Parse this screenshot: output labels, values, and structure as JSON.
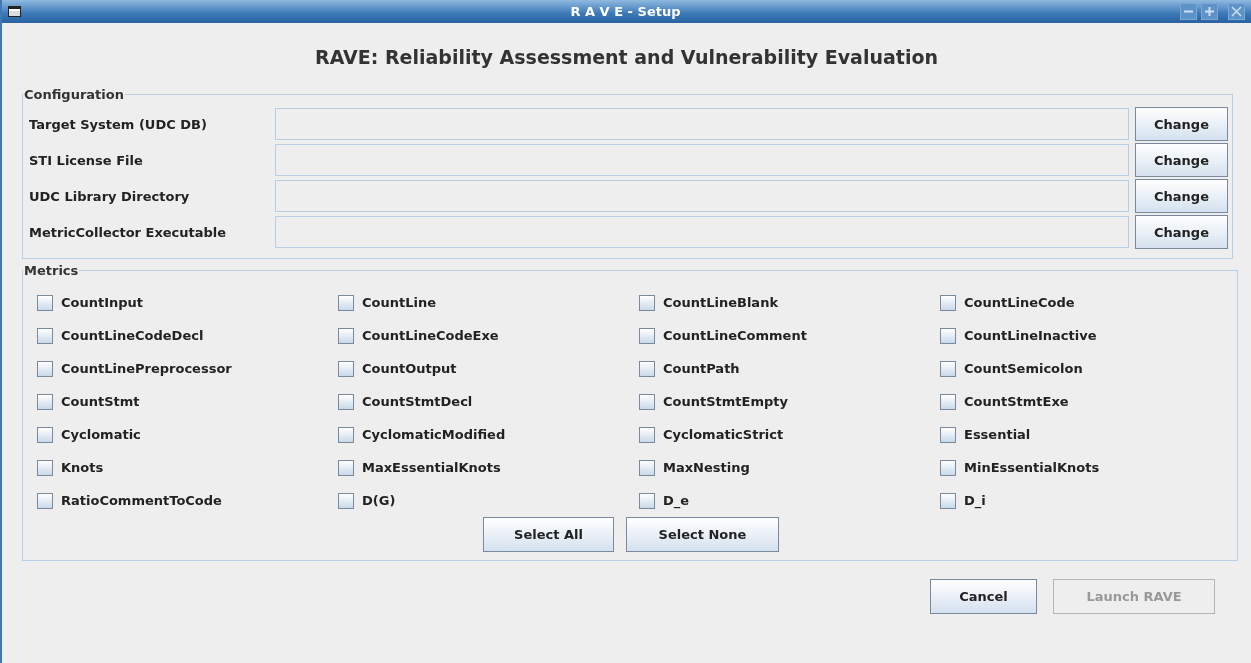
{
  "window": {
    "title": "R A V E - Setup"
  },
  "heading": "RAVE: Reliability Assessment and Vulnerability Evaluation",
  "configuration": {
    "legend": "Configuration",
    "rows": [
      {
        "label": "Target System (UDC DB)",
        "button": "Change"
      },
      {
        "label": "STI License File",
        "button": "Change"
      },
      {
        "label": "UDC Library Directory",
        "button": "Change"
      },
      {
        "label": "MetricCollector Executable",
        "button": "Change"
      }
    ]
  },
  "metrics": {
    "legend": "Metrics",
    "items": [
      {
        "label": "CountInput",
        "checked": false
      },
      {
        "label": "CountLine",
        "checked": false
      },
      {
        "label": "CountLineBlank",
        "checked": false
      },
      {
        "label": "CountLineCode",
        "checked": false
      },
      {
        "label": "CountLineCodeDecl",
        "checked": false
      },
      {
        "label": "CountLineCodeExe",
        "checked": false
      },
      {
        "label": "CountLineComment",
        "checked": false
      },
      {
        "label": "CountLineInactive",
        "checked": false
      },
      {
        "label": "CountLinePreprocessor",
        "checked": false
      },
      {
        "label": "CountOutput",
        "checked": false
      },
      {
        "label": "CountPath",
        "checked": false
      },
      {
        "label": "CountSemicolon",
        "checked": false
      },
      {
        "label": "CountStmt",
        "checked": false
      },
      {
        "label": "CountStmtDecl",
        "checked": false
      },
      {
        "label": "CountStmtEmpty",
        "checked": false
      },
      {
        "label": "CountStmtExe",
        "checked": false
      },
      {
        "label": "Cyclomatic",
        "checked": false
      },
      {
        "label": "CyclomaticModified",
        "checked": false
      },
      {
        "label": "CyclomaticStrict",
        "checked": false
      },
      {
        "label": "Essential",
        "checked": false
      },
      {
        "label": "Knots",
        "checked": false
      },
      {
        "label": "MaxEssentialKnots",
        "checked": false
      },
      {
        "label": "MaxNesting",
        "checked": false
      },
      {
        "label": "MinEssentialKnots",
        "checked": false
      },
      {
        "label": "RatioCommentToCode",
        "checked": false
      },
      {
        "label": "D(G)",
        "checked": false
      },
      {
        "label": "D_e",
        "checked": false
      },
      {
        "label": "D_i",
        "checked": false
      }
    ],
    "buttons": [
      "Select All",
      "Select None"
    ]
  },
  "footer": [
    {
      "label": "Cancel",
      "disabled": false
    },
    {
      "label": "Launch RAVE",
      "disabled": true
    }
  ]
}
